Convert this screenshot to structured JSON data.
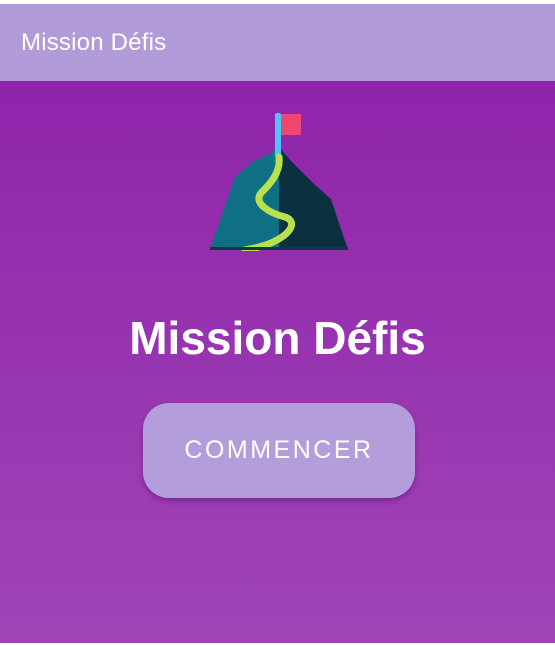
{
  "app_bar": {
    "title": "Mission Défis"
  },
  "hero": {
    "logo_icon": "mountain-flag-icon",
    "title": "Mission Défis"
  },
  "actions": {
    "start_label": "COMMENCER"
  },
  "colors": {
    "app_bar": "#b19cd9",
    "background_top": "#8e24aa",
    "background_bottom": "#a044b6",
    "button": "#b39ddb",
    "text": "#ffffff",
    "flag": "#ef476f",
    "trail": "#b7e14f"
  }
}
